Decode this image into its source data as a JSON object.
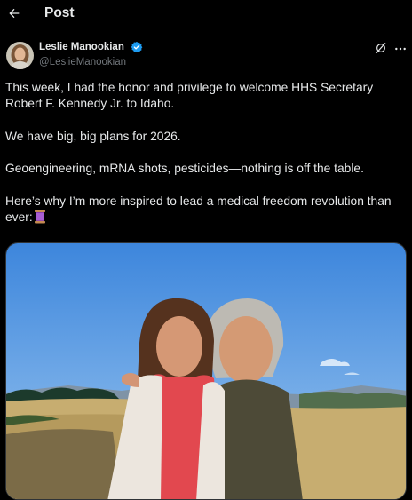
{
  "header": {
    "back_icon": "arrow-left-icon",
    "title": "Post"
  },
  "author": {
    "name": "Leslie Manookian",
    "handle": "@LeslieManookian",
    "verified": true,
    "verified_color": "#1d9bf0"
  },
  "actions": {
    "grok_icon": "grok-icon",
    "more_icon": "more-horizontal-icon"
  },
  "tweet": {
    "paragraphs": [
      "This week, I had the honor and privilege to welcome HHS Secretary Robert F. Kennedy Jr. to Idaho.",
      "We have big, big plans for 2026.",
      "Geoengineering, mRNA shots, pesticides—nothing is off the table.",
      "Here’s why I’m more inspired to lead a medical freedom revolution than ever:"
    ],
    "trailing_emoji": "spool-of-thread-emoji"
  },
  "media": {
    "type": "photo",
    "icon": "photo-two-people-outdoors"
  },
  "colors": {
    "background": "#000000",
    "text": "#e7e9ea",
    "secondary_text": "#71767b",
    "accent": "#1d9bf0"
  }
}
